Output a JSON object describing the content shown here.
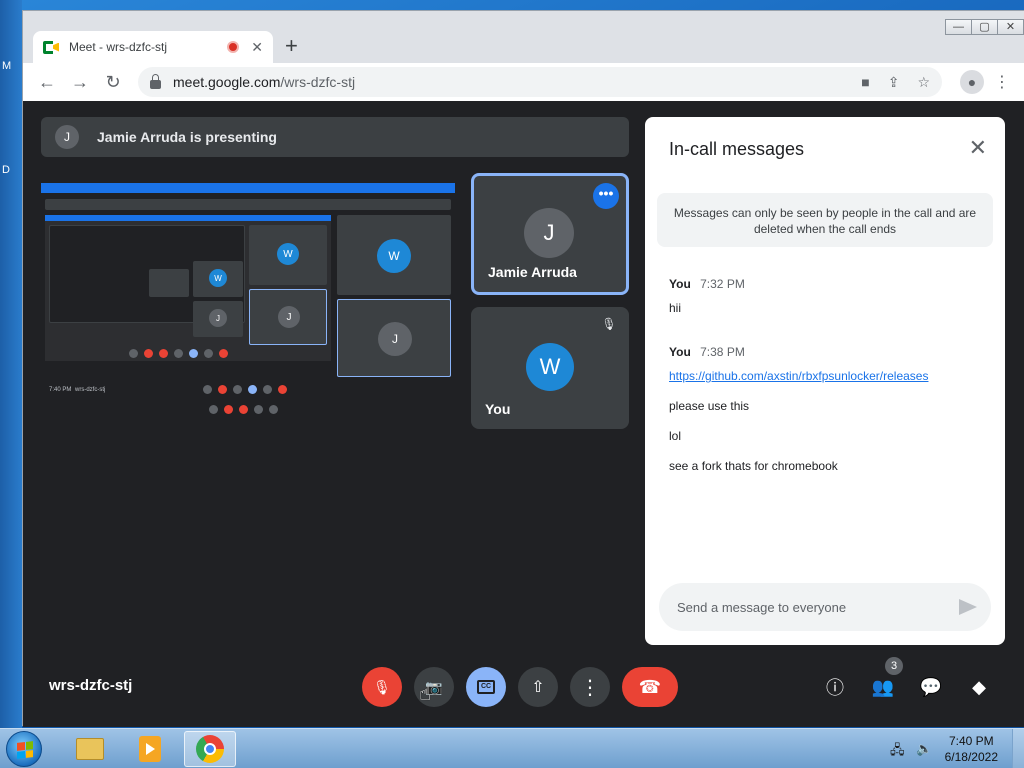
{
  "desktop": {
    "glyph_m": "M",
    "glyph_d": "D"
  },
  "window": {
    "controls": {
      "minimize": "—",
      "maximize": "▢",
      "close": "✕"
    }
  },
  "browser": {
    "tab_title": "Meet - wrs-dzfc-stj",
    "tab_close": "✕",
    "new_tab": "+",
    "url_host": "meet.google.com",
    "url_path": "/wrs-dzfc-stj",
    "nav": {
      "back": "←",
      "forward": "→",
      "reload": "↻"
    },
    "omni_icons": {
      "camera": "■",
      "share": "⇪",
      "bookmark": "☆"
    },
    "profile": "●",
    "menu": "⋮"
  },
  "meet": {
    "presenter_initial": "J",
    "presenting_text": "Jamie Arruda is presenting",
    "shared_screen": {
      "avatar_w": "W",
      "avatar_j": "J",
      "time": "7:40 PM",
      "code": "wrs-dzfc-stj"
    },
    "tiles": [
      {
        "initial": "J",
        "name": "Jamie Arruda",
        "more": "•••",
        "avatar_color": "#5f6368"
      },
      {
        "initial": "W",
        "name": "You",
        "mute": "🎙",
        "avatar_color": "#1e88d6"
      }
    ],
    "meeting_code": "wrs-dzfc-stj",
    "controls": {
      "mic": "🎙",
      "camera": "📷",
      "captions": "CC",
      "present": "⇧",
      "more": "⋮",
      "hangup": "☎"
    },
    "side": {
      "info": "ⓘ",
      "people": "👥",
      "people_count": "3",
      "chat": "💬",
      "activities": "◆"
    }
  },
  "chat": {
    "title": "In-call messages",
    "close": "✕",
    "notice": "Messages can only be seen by people in the call and are deleted when the call ends",
    "groups": [
      {
        "sender": "You",
        "time": "7:32 PM",
        "lines": [
          "hii"
        ]
      },
      {
        "sender": "You",
        "time": "7:38 PM",
        "link": "https://github.com/axstin/rbxfpsunlocker/releases",
        "lines": [
          "please use this",
          "lol",
          "see a fork thats for chromebook"
        ]
      }
    ],
    "input_placeholder": "Send a message to everyone",
    "input_value": ""
  },
  "taskbar": {
    "tray_network": "🖧",
    "tray_volume": "🔈",
    "clock_time": "7:40 PM",
    "clock_date": "6/18/2022"
  },
  "colors": {
    "meet_bg": "#202124",
    "tile_bg": "#3c4043",
    "accent_blue": "#8ab4f8",
    "hangup_red": "#ea4335",
    "link_blue": "#1a73e8"
  }
}
